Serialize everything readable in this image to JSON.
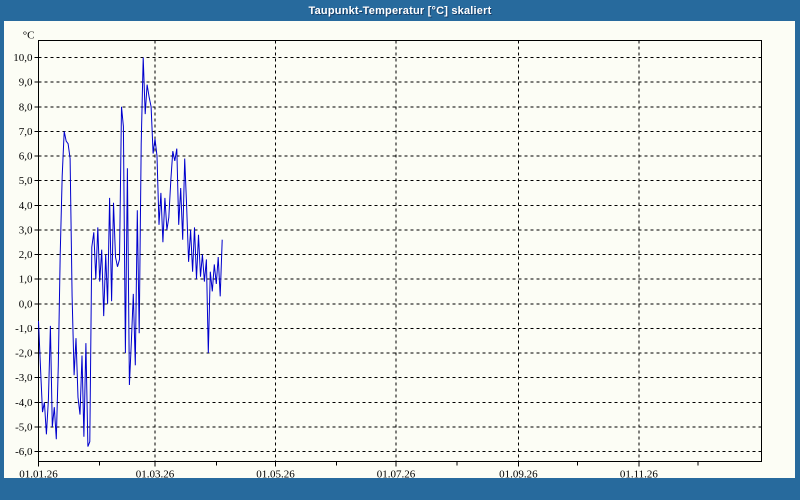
{
  "window": {
    "title": "Taupunkt-Temperatur [°C] skaliert"
  },
  "colors": {
    "titlebar": "#276a9d",
    "frame": "#276a9d",
    "content_bg": "#fcfdf5",
    "plot_border": "#000000",
    "gridline": "#000000",
    "tick_label": "#000000",
    "title_text": "#ffffff",
    "series_line": "#0000cd"
  },
  "chart_data": {
    "type": "line",
    "title": "Taupunkt-Temperatur [°C] skaliert",
    "xlabel": "",
    "ylabel": "°C",
    "grid": "dashed",
    "legend": "none",
    "y_axis": {
      "min": -6,
      "max": 10,
      "step": 1,
      "ticks": [
        {
          "value": 10,
          "label": "10,0"
        },
        {
          "value": 9,
          "label": "9,0"
        },
        {
          "value": 8,
          "label": "8,0"
        },
        {
          "value": 7,
          "label": "7,0"
        },
        {
          "value": 6,
          "label": "6,0"
        },
        {
          "value": 5,
          "label": "5,0"
        },
        {
          "value": 4,
          "label": "4,0"
        },
        {
          "value": 3,
          "label": "3,0"
        },
        {
          "value": 2,
          "label": "2,0"
        },
        {
          "value": 1,
          "label": "1,0"
        },
        {
          "value": 0,
          "label": "0,0"
        },
        {
          "value": -1,
          "label": "-1,0"
        },
        {
          "value": -2,
          "label": "-2,0"
        },
        {
          "value": -3,
          "label": "-3,0"
        },
        {
          "value": -4,
          "label": "-4,0"
        },
        {
          "value": -5,
          "label": "-5,0"
        },
        {
          "value": -6,
          "label": "-6,0"
        }
      ]
    },
    "x_axis": {
      "unit": "date",
      "range_days": [
        0,
        366
      ],
      "major_ticks": [
        {
          "day": 0,
          "label": "01.01.26"
        },
        {
          "day": 59,
          "label": "01.03.26"
        },
        {
          "day": 120,
          "label": "01.05.26"
        },
        {
          "day": 181,
          "label": "01.07.26"
        },
        {
          "day": 243,
          "label": "01.09.26"
        },
        {
          "day": 304,
          "label": "01.11.26"
        }
      ],
      "minor_tick_days": [
        31,
        90,
        151,
        212,
        273,
        334
      ],
      "gridline_days": [
        59,
        120,
        181,
        243,
        304
      ]
    },
    "series": [
      {
        "name": "Taupunkt-Temperatur",
        "color": "#0000cd",
        "start_day": 0,
        "interval_days": 1,
        "values": [
          -0.7,
          -2.6,
          -4.4,
          -4.0,
          -5.3,
          -3.9,
          -0.9,
          -5.0,
          -4.2,
          -5.5,
          -2.5,
          2.0,
          5.2,
          7.0,
          6.6,
          6.5,
          5.9,
          0.3,
          -2.9,
          -1.4,
          -3.8,
          -4.5,
          -2.1,
          -5.4,
          -1.6,
          -5.8,
          -5.6,
          2.3,
          2.9,
          1.0,
          3.1,
          0.9,
          2.2,
          -0.5,
          2.0,
          0.0,
          4.3,
          0.1,
          4.1,
          1.9,
          1.5,
          1.8,
          8.0,
          7.2,
          -2.0,
          5.5,
          -3.3,
          -1.6,
          0.4,
          -2.5,
          3.8,
          -1.2,
          6.5,
          10.0,
          7.7,
          8.9,
          8.4,
          8.0,
          6.1,
          6.7,
          6.0,
          3.2,
          4.5,
          2.5,
          4.3,
          3.0,
          3.5,
          5.0,
          6.2,
          5.8,
          6.3,
          3.2,
          4.7,
          2.6,
          5.9,
          4.0,
          1.7,
          3.0,
          1.3,
          3.1,
          1.0,
          2.8,
          1.1,
          2.0,
          0.9,
          1.8,
          -2.0,
          1.3,
          0.5,
          1.6,
          0.8,
          1.9,
          0.3,
          2.6
        ]
      }
    ]
  }
}
